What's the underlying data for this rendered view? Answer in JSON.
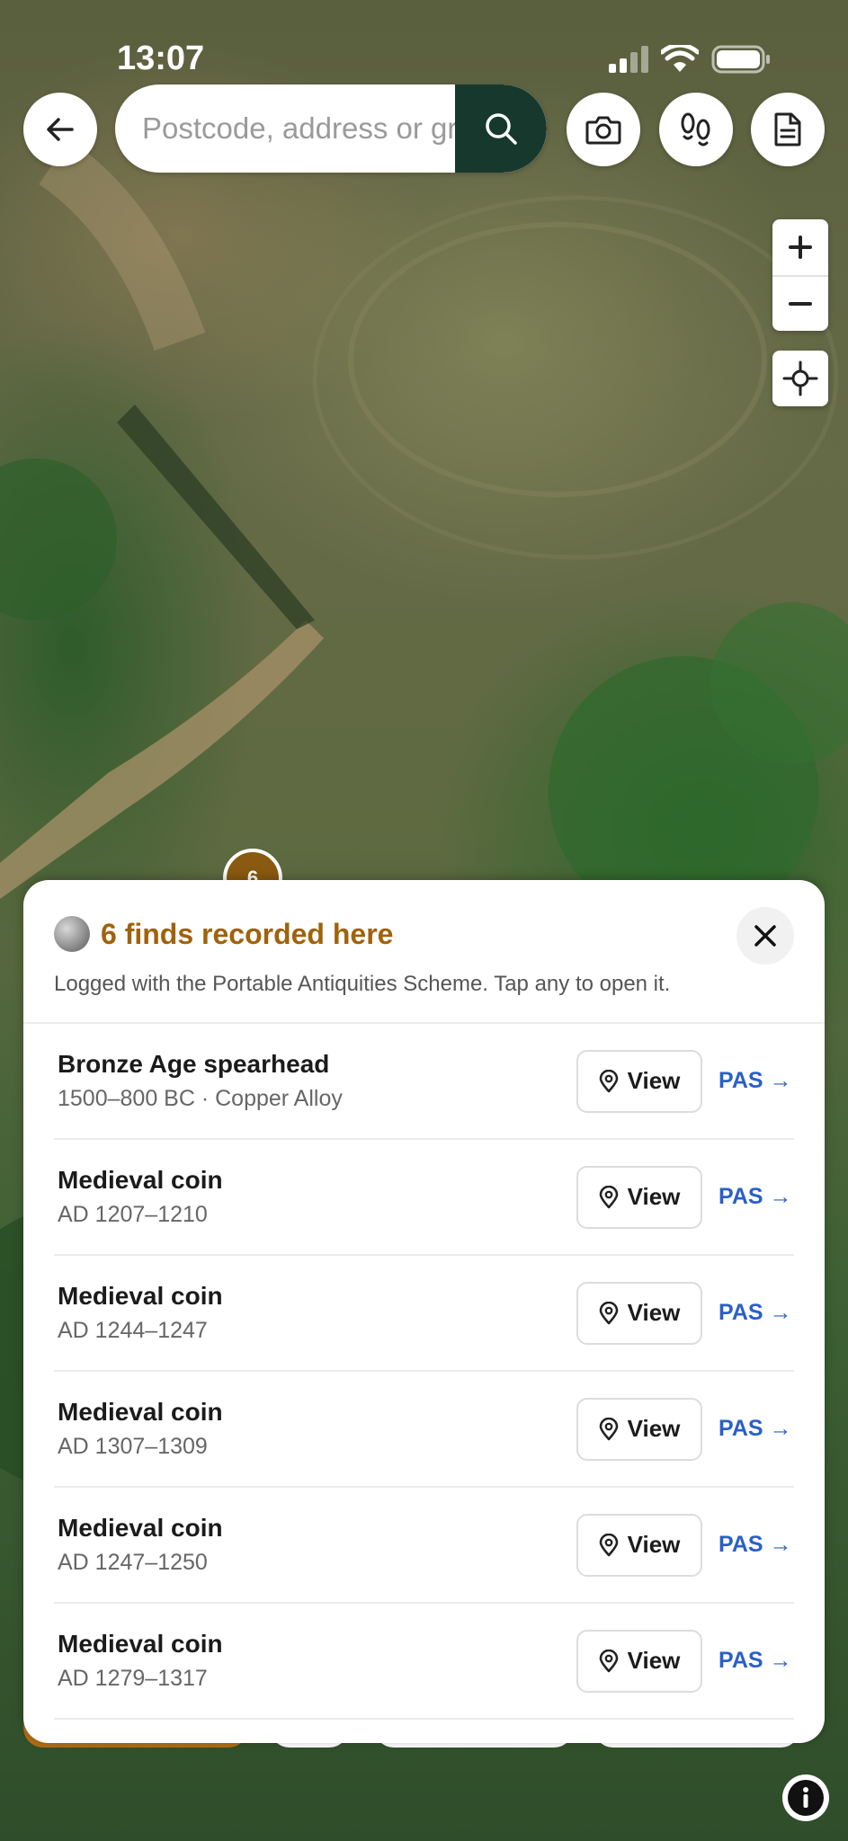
{
  "status_bar": {
    "time": "13:07"
  },
  "search": {
    "placeholder": "Postcode, address or grid reference"
  },
  "map": {
    "marker_count": "6"
  },
  "finds_sheet": {
    "title": "6 finds recorded here",
    "subtitle": "Logged with the Portable Antiquities Scheme. Tap any to open it.",
    "view_label": "View",
    "pas_label": "PAS →",
    "items": [
      {
        "title": "Bronze Age spearhead",
        "meta": "1500–800 BC · Copper Alloy"
      },
      {
        "title": "Medieval coin",
        "meta": "AD 1207–1210"
      },
      {
        "title": "Medieval coin",
        "meta": "AD 1244–1247"
      },
      {
        "title": "Medieval coin",
        "meta": "AD 1307–1309"
      },
      {
        "title": "Medieval coin",
        "meta": "AD 1247–1250"
      },
      {
        "title": "Medieval coin",
        "meta": "AD 1279–1317"
      }
    ]
  },
  "colors": {
    "accent": "#a0620c",
    "search_button": "#17392d",
    "link": "#2b5fc9"
  },
  "icons": {
    "back": "arrow-left-icon",
    "search": "search-icon",
    "camera": "camera-icon",
    "footprints": "footprints-icon",
    "document": "document-icon",
    "zoom_in": "plus-icon",
    "zoom_out": "minus-icon",
    "locate": "crosshair-icon",
    "close": "close-icon",
    "pin": "map-pin-icon",
    "info": "info-icon"
  }
}
